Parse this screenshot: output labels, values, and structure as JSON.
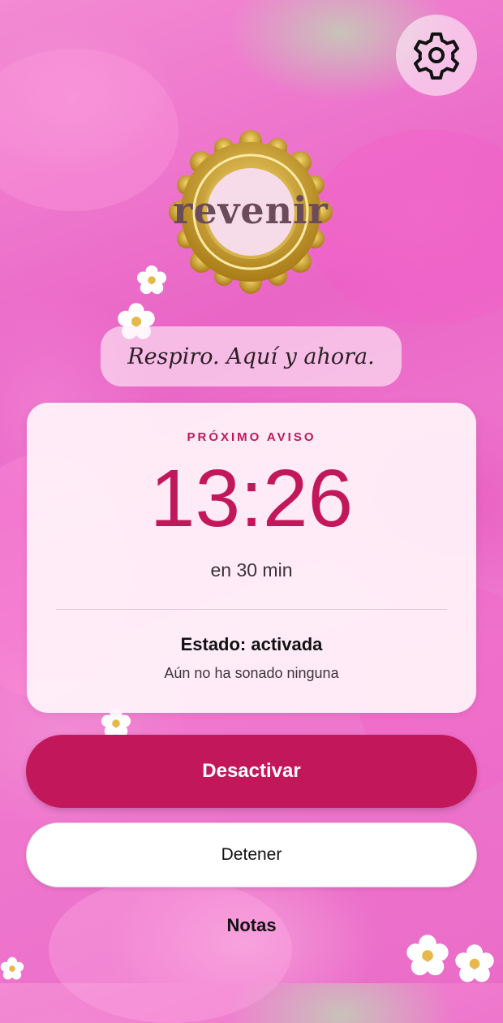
{
  "header": {
    "settings_icon": "gear-icon",
    "logo_text": "revenir"
  },
  "tagline": "Respiro. Aquí y ahora.",
  "next_alert": {
    "label": "PRÓXIMO AVISO",
    "time": "13:26",
    "relative": "en 30 min",
    "status": "Estado: activada",
    "note": "Aún no ha sonado ninguna"
  },
  "actions": {
    "primary_label": "Desactivar",
    "secondary_label": "Detener",
    "notes_label": "Notas"
  },
  "colors": {
    "accent": "#c2185b",
    "gold": "#c9a227",
    "background_pink": "#ea6cc8"
  }
}
